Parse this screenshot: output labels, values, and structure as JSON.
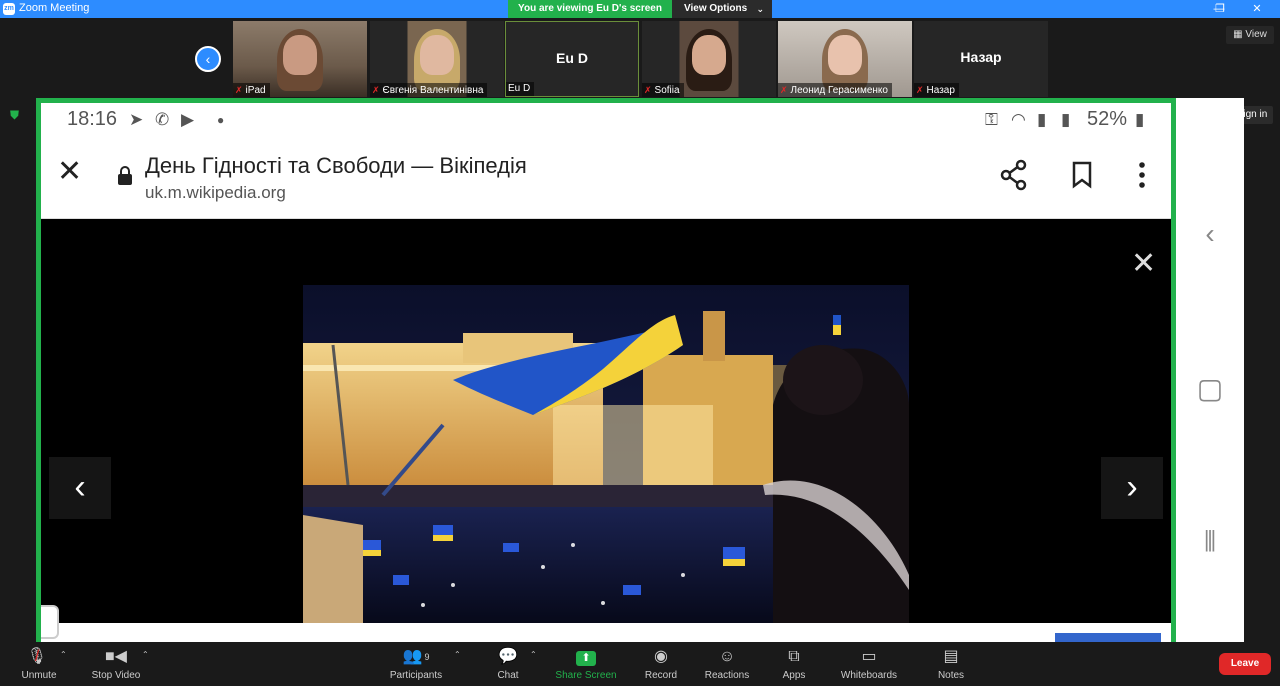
{
  "window": {
    "title": "Zoom Meeting",
    "logo": "zm",
    "minimize": "—",
    "restore": "❐",
    "close": "✕"
  },
  "banner": {
    "viewing": "You are viewing Eu D's screen",
    "view_options": "View Options",
    "caret": "⌄"
  },
  "strip": {
    "prev_icon": "‹",
    "view_button": "View",
    "tiles": [
      {
        "name": "iPad",
        "muted": true,
        "video": true
      },
      {
        "name": "Євгенія Валентинівна",
        "muted": true,
        "video": true
      },
      {
        "name": "Eu D",
        "big_name": "Eu D",
        "muted": false,
        "video": false
      },
      {
        "name": "Sofiia",
        "muted": true,
        "video": true
      },
      {
        "name": "Леонид Герасименко",
        "muted": true,
        "video": true
      },
      {
        "name": "Назар",
        "big_name": "Назар",
        "muted": true,
        "video": false
      }
    ],
    "mic_muted_icon": "mic-muted-icon"
  },
  "sign_in": "Sign in",
  "shared_screen": {
    "status_bar": {
      "time": "18:16",
      "battery": "52%"
    },
    "browser": {
      "page_title": "День Гідності та Свободи — Вікіпедія",
      "url": "uk.m.wikipedia.org"
    },
    "viewer": {
      "close_icon": "✕",
      "prev_icon": "‹",
      "next_icon": "›"
    }
  },
  "android_nav": {
    "back": "‹",
    "home": "▢",
    "recents": "⦀"
  },
  "toolbar": {
    "unmute": "Unmute",
    "stop_video": "Stop Video",
    "participants": "Participants",
    "participants_count": "9",
    "chat": "Chat",
    "share_screen": "Share Screen",
    "record": "Record",
    "reactions": "Reactions",
    "apps": "Apps",
    "whiteboards": "Whiteboards",
    "notes": "Notes",
    "leave": "Leave",
    "caret": "⌃"
  },
  "colors": {
    "zoom_blue": "#2d8cff",
    "share_green": "#22b14c",
    "leave_red": "#e02828",
    "toolbar_bg": "#1a1a1a"
  }
}
